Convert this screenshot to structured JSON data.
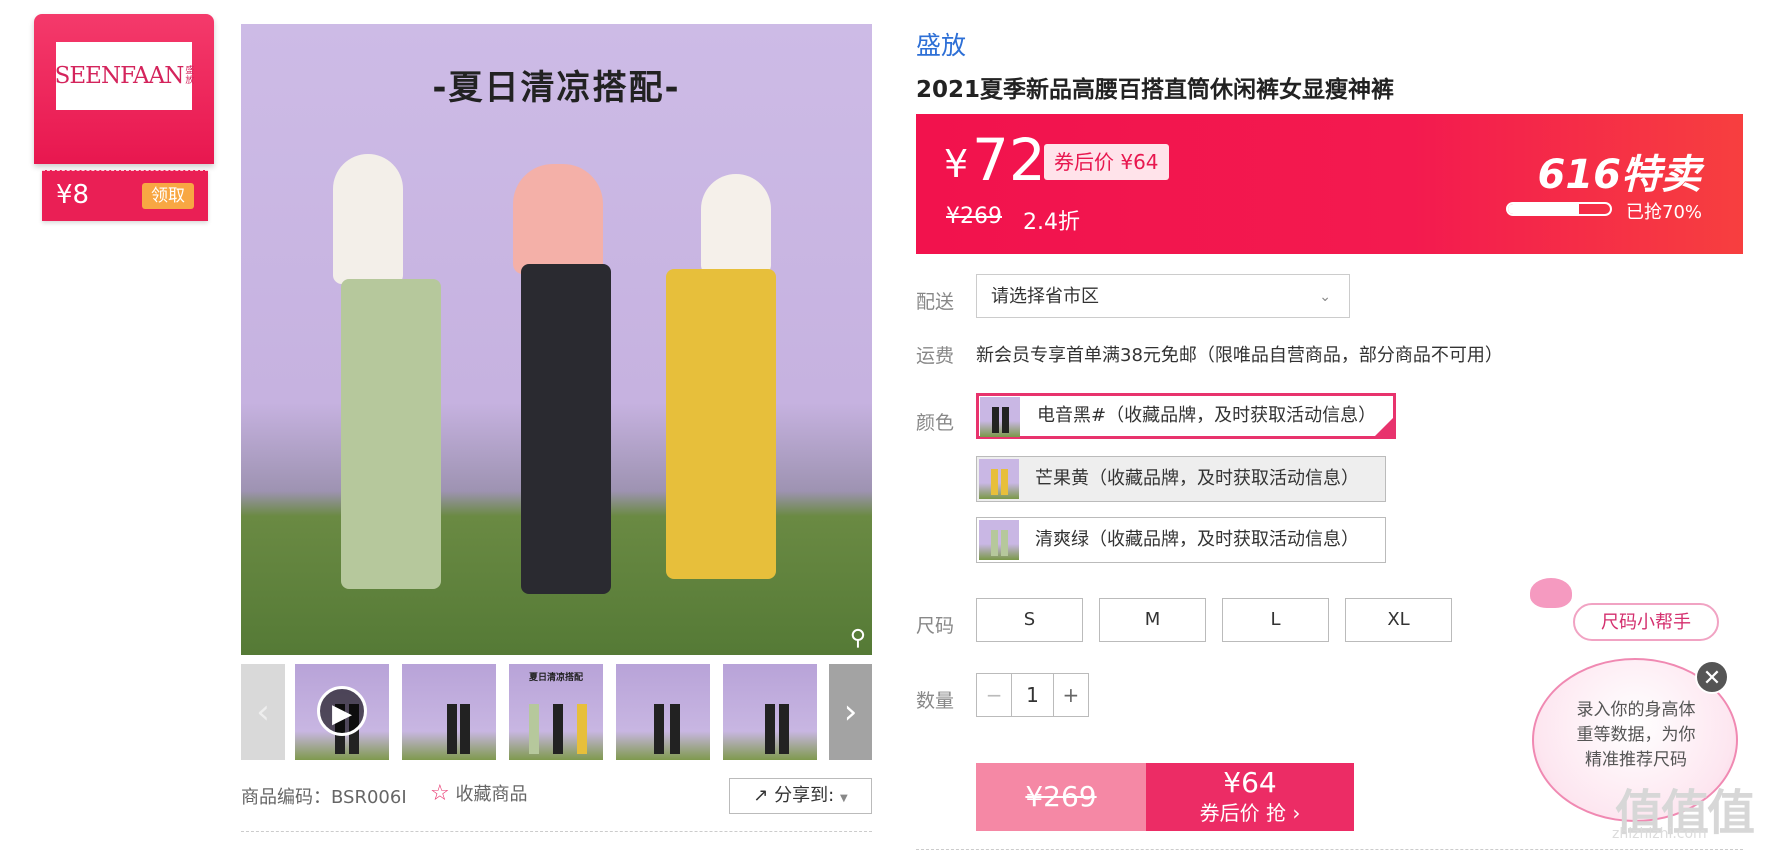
{
  "brand_coupon": {
    "logo_text": "SEENFAAN",
    "logo_cn": "盛放",
    "amount": "¥8",
    "claim_label": "领取"
  },
  "gallery": {
    "main_image_title": "-夏日清凉搭配-",
    "prev_arrow": "‹",
    "next_arrow": "›",
    "zoom_icon": "magnifier-icon",
    "thumb_title": "夏日清凉搭配",
    "product_code": "商品编码：BSR006I",
    "favorite_label": "收藏商品",
    "share_label": "分享到:"
  },
  "product": {
    "brand": "盛放",
    "title": "2021夏季新品高腰百搭直筒休闲裤女显瘦神裤"
  },
  "price": {
    "currency": "¥",
    "current": "72",
    "coupon_tag": "券后价 ¥64",
    "original": "¥269",
    "discount": "2.4折",
    "promo_label": "616特卖",
    "sold_text": "已抢70%",
    "sold_fraction": 0.7
  },
  "delivery": {
    "label": "配送",
    "placeholder": "请选择省市区"
  },
  "shipping": {
    "label": "运费",
    "text": "新会员专享首单满38元免邮（限唯品自营商品，部分商品不可用）"
  },
  "colors": {
    "label": "颜色",
    "options": [
      {
        "name": "电音黑#（收藏品牌，及时获取活动信息）",
        "state": "selected"
      },
      {
        "name": "芒果黄（收藏品牌，及时获取活动信息）",
        "state": "disabled"
      },
      {
        "name": "清爽绿（收藏品牌，及时获取活动信息）",
        "state": "normal"
      }
    ]
  },
  "sizes": {
    "label": "尺码",
    "options": [
      "S",
      "M",
      "L",
      "XL"
    ]
  },
  "quantity": {
    "label": "数量",
    "minus": "−",
    "value": "1",
    "plus": "+"
  },
  "buy": {
    "original": "¥269",
    "price": "¥64",
    "cta": "券后价 抢 ›"
  },
  "size_helper": {
    "tag": "尺码小帮手",
    "bubble_text": "录入你的身高体重等数据，为你精准推荐尺码",
    "close": "✕"
  },
  "watermark": {
    "text": "值值值",
    "domain": "zhizhizhi.com"
  },
  "colors_theme": {
    "accent": "#e8174f",
    "brand_blue": "#2d6fd6",
    "coupon_orange": "#f8a743"
  }
}
